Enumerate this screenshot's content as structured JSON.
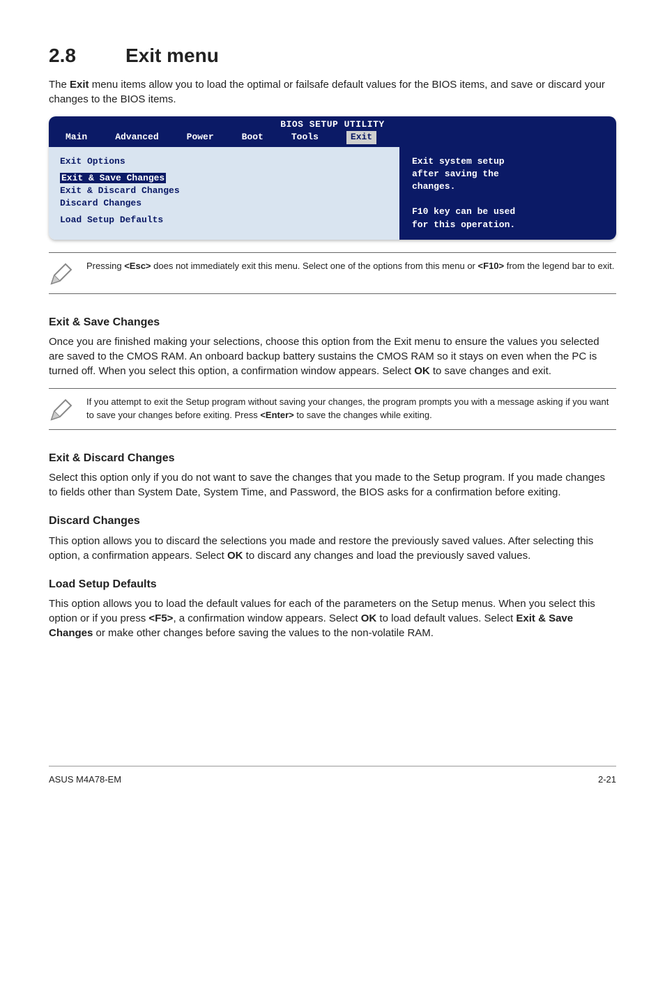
{
  "heading": {
    "num": "2.8",
    "title": "Exit menu"
  },
  "intro": {
    "a": "The ",
    "b": "Exit",
    "c": " menu items allow you to load the optimal or failsafe default values for the BIOS items, and save or discard your changes to the BIOS items."
  },
  "bios": {
    "title": "BIOS SETUP UTILITY",
    "tabs": {
      "main": "Main",
      "advanced": "Advanced",
      "power": "Power",
      "boot": "Boot",
      "tools": "Tools",
      "exit": "Exit"
    },
    "left": {
      "l1": "Exit Options",
      "l2": "Exit & Save Changes",
      "l3": "Exit & Discard Changes",
      "l4": "Discard Changes",
      "l5": "Load Setup Defaults"
    },
    "right": "Exit system setup\nafter saving the\nchanges.\n\nF10 key can be used\nfor this operation."
  },
  "note1": {
    "a": "Pressing ",
    "b": "<Esc>",
    "c": " does not immediately exit this menu. Select one of the options from this menu or ",
    "d": "<F10>",
    "e": " from the legend bar to exit."
  },
  "save": {
    "h": "Exit & Save Changes",
    "p": {
      "a": "Once you are finished making your selections, choose this option from the Exit menu to ensure the values you selected are saved to the CMOS RAM. An onboard backup battery sustains the CMOS RAM so it stays on even when the PC is turned off. When you select this option, a confirmation window appears. Select ",
      "b": "OK",
      "c": " to save changes and exit."
    }
  },
  "note2": {
    "a": " If you attempt to exit the Setup program without saving your changes, the program prompts you with a message asking if you want to save your changes before exiting. Press ",
    "b": "<Enter>",
    "c": " to save the changes while exiting."
  },
  "discard1": {
    "h": "Exit & Discard Changes",
    "p": "Select this option only if you do not want to save the changes that you made to the Setup program. If you made changes to fields other than System Date, System Time, and Password, the BIOS asks for a confirmation before exiting."
  },
  "discard2": {
    "h": "Discard Changes",
    "p": {
      "a": "This option allows you to discard the selections you made and restore the previously saved values. After selecting this option, a confirmation appears. Select ",
      "b": "OK",
      "c": " to discard any changes and load the previously saved values."
    }
  },
  "load": {
    "h": "Load Setup Defaults",
    "p": {
      "a": "This option allows you to load the default values for each of the parameters on the Setup menus. When you select this option or if you press ",
      "b": "<F5>",
      "c": ", a confirmation window appears. Select ",
      "d": "OK",
      "e": " to load default values. Select ",
      "f": "Exit & Save Changes",
      "g": " or make other changes before saving the values to the non-volatile RAM."
    }
  },
  "footer": {
    "left": "ASUS M4A78-EM",
    "right": "2-21"
  }
}
